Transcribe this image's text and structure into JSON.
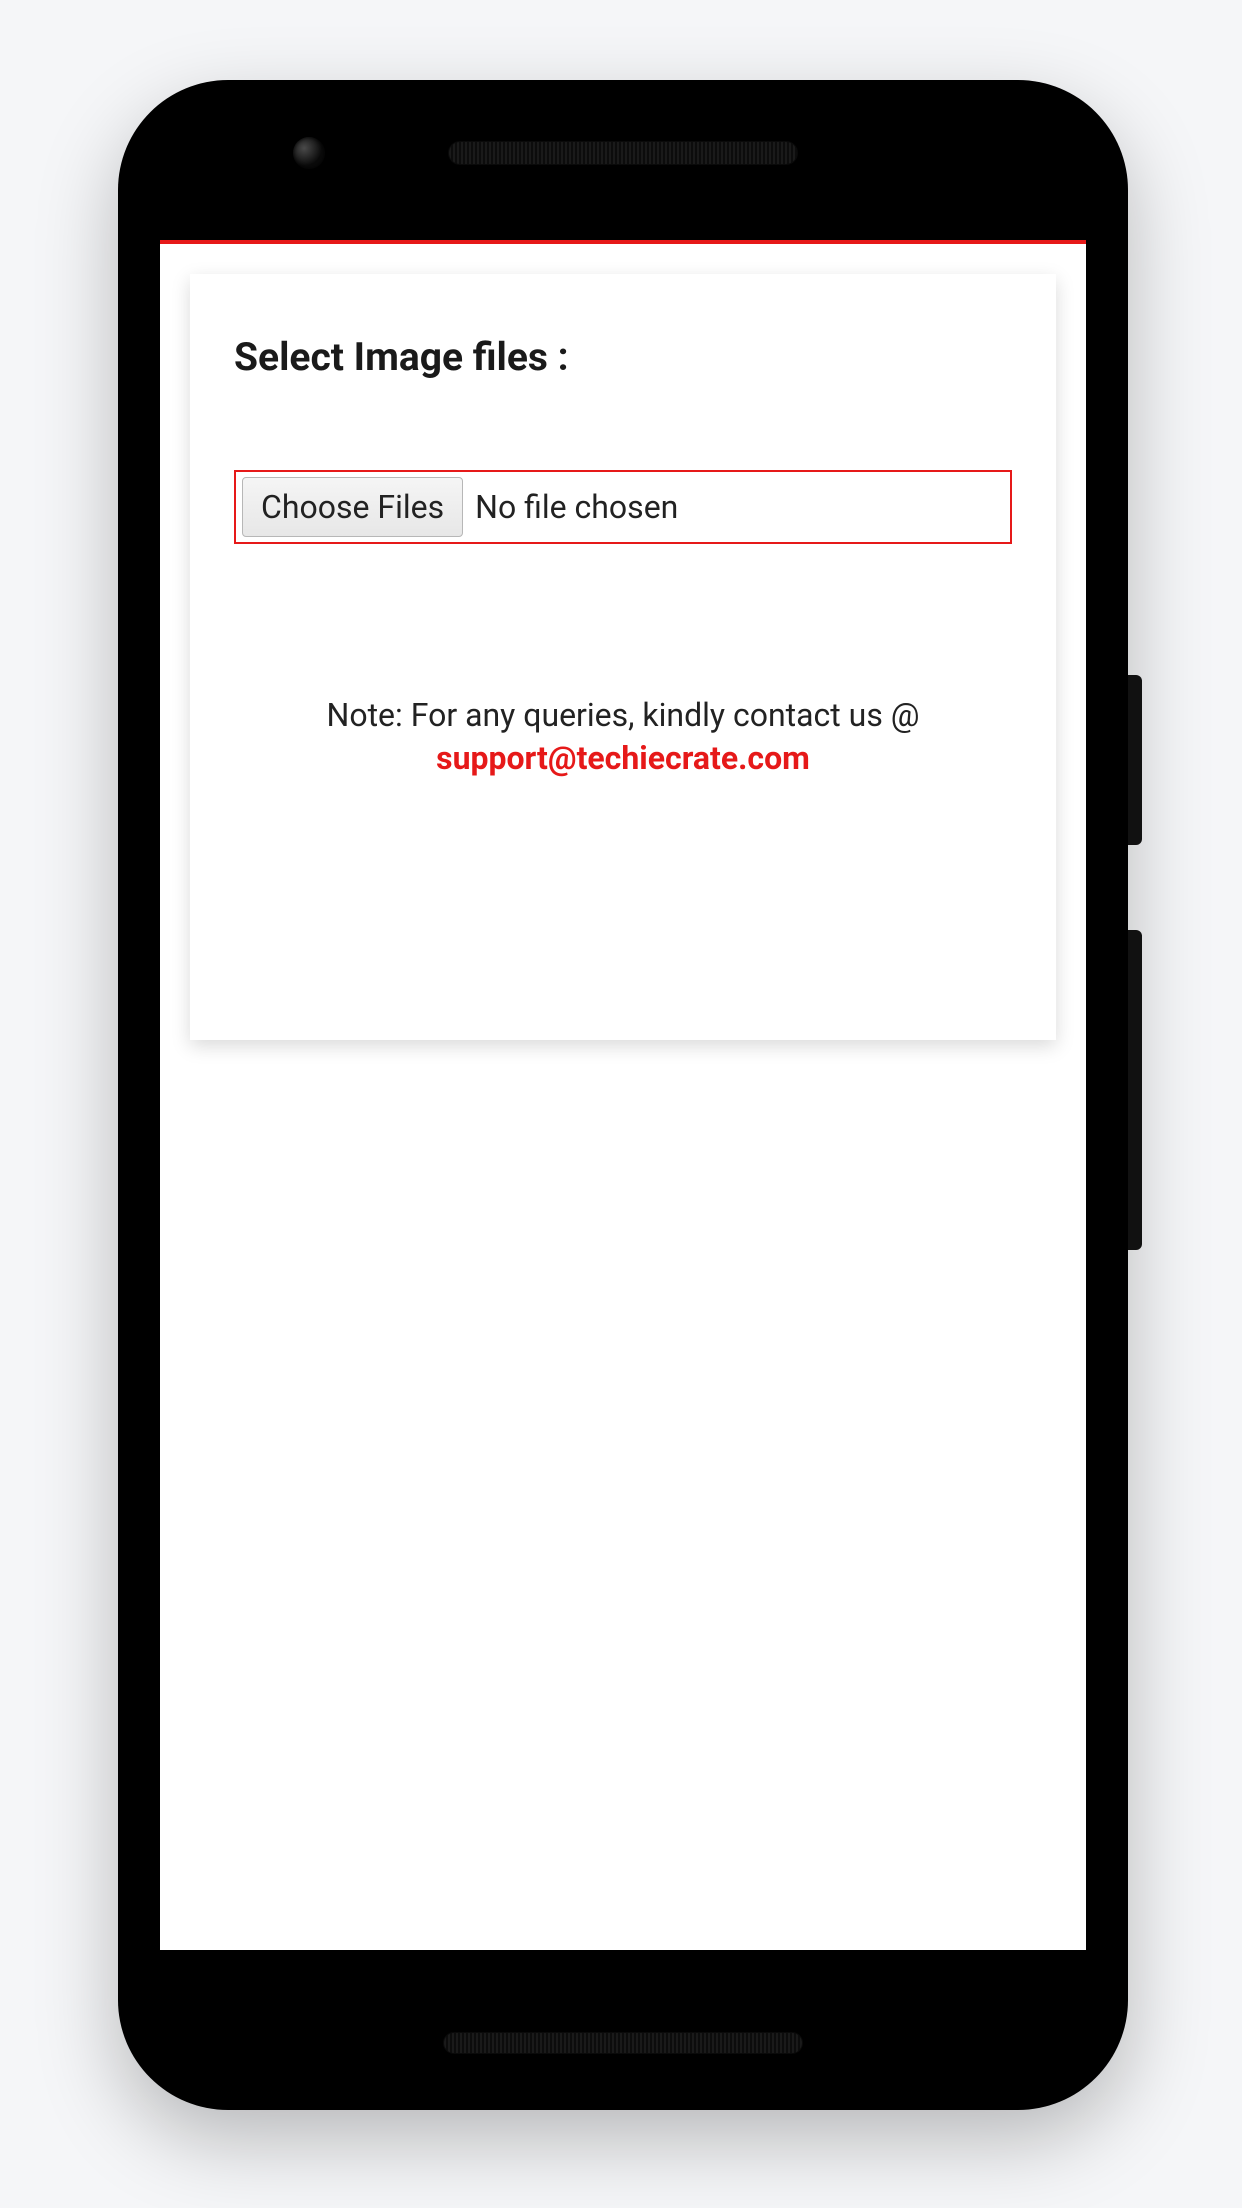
{
  "card": {
    "heading": "Select Image files :",
    "file_input": {
      "button_label": "Choose Files",
      "status_text": "No file chosen"
    },
    "note": {
      "prefix": "Note: For any queries, kindly contact us @",
      "email": "support@techiecrate.com"
    }
  },
  "colors": {
    "accent": "#e61919"
  }
}
